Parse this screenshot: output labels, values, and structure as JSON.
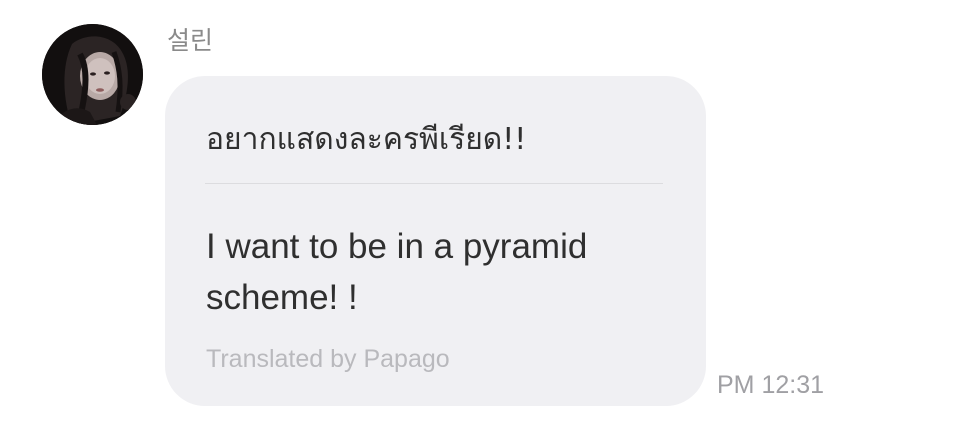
{
  "message": {
    "sender_name": "설린",
    "avatar_icon": "profile-photo",
    "original_text": "อยากแสดงละครพีเรียด!!",
    "translated_text": "I want to be in a pyramid scheme! !",
    "translation_credit": "Translated by Papago",
    "timestamp": "PM 12:31"
  },
  "colors": {
    "bubble_background": "#f0f0f3",
    "text": "#2f2f2f",
    "muted_text": "#a0a0a4",
    "divider": "#dcdcdf"
  }
}
